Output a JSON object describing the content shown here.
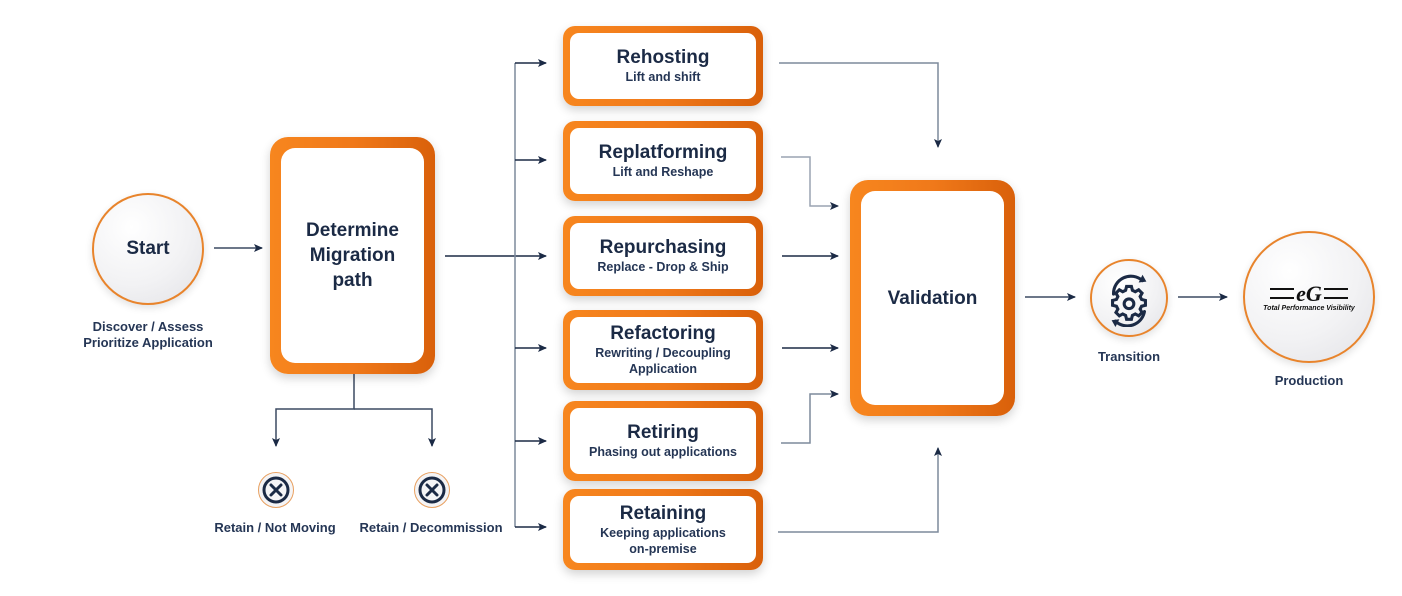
{
  "colors": {
    "accent_orange": "#f0791a",
    "text_navy": "#1b2a45",
    "connector_gray": "#7d8a9c"
  },
  "start": {
    "label": "Start",
    "caption_line1": "Discover / Assess",
    "caption_line2": "Prioritize Application"
  },
  "determine": {
    "line1": "Determine",
    "line2": "Migration",
    "line3": "path"
  },
  "exits": [
    {
      "label": "Retain / Not Moving",
      "icon": "x-circle-icon"
    },
    {
      "label": "Retain / Decommission",
      "icon": "x-circle-icon"
    }
  ],
  "strategies": [
    {
      "title": "Rehosting",
      "sub1": "Lift and shift",
      "sub2": ""
    },
    {
      "title": "Replatforming",
      "sub1": "Lift and Reshape",
      "sub2": ""
    },
    {
      "title": "Repurchasing",
      "sub1": "Replace - Drop & Ship",
      "sub2": ""
    },
    {
      "title": "Refactoring",
      "sub1": "Rewriting / Decoupling",
      "sub2": "Application"
    },
    {
      "title": "Retiring",
      "sub1": "Phasing out applications",
      "sub2": ""
    },
    {
      "title": "Retaining",
      "sub1": "Keeping applications",
      "sub2": "on-premise"
    }
  ],
  "validation": {
    "label": "Validation"
  },
  "transition": {
    "label": "Transition",
    "icon": "gear-cycle-icon"
  },
  "production": {
    "label": "Production",
    "logo_text": "eG",
    "logo_tagline": "Total Performance Visibility"
  }
}
